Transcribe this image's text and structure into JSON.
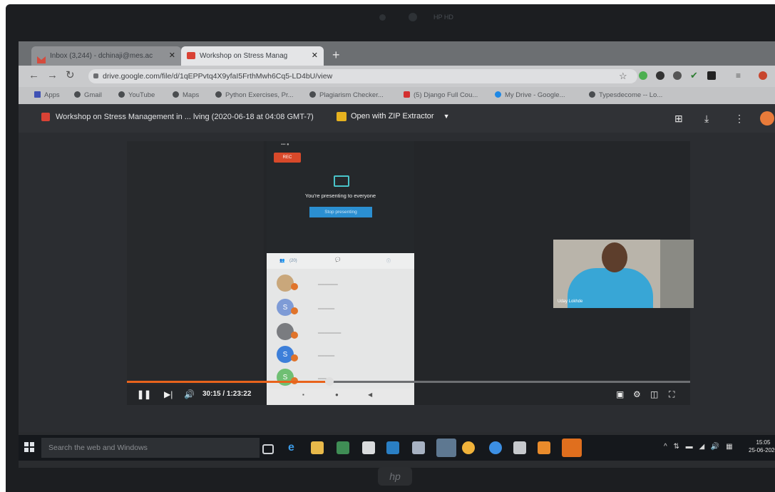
{
  "tabs": [
    {
      "label": "Inbox (3,244) - dchinaji@mes.ac",
      "icon": "gmail-icon",
      "active": false
    },
    {
      "label": "Workshop on Stress Manag",
      "icon": "drive-slides-icon",
      "active": true
    }
  ],
  "omnibox": {
    "url": "drive.google.com/file/d/1qEPPvtq4X9yfaI5FrthMwh6Cq5-LD4bU/view"
  },
  "bookmarks": [
    "Apps",
    "Gmail",
    "YouTube",
    "Maps",
    "Python Exercises, Pr...",
    "Plagiarism Checker...",
    "(5) Django Full Cou...",
    "My Drive - Google...",
    "Typesdecome -- Lo..."
  ],
  "viewer": {
    "title": "Workshop on Stress Management in ... lving (2020-06-18 at 04:08 GMT-7)",
    "open_with": "Open with ZIP Extractor"
  },
  "video": {
    "rec_label": "REC",
    "presenting_text": "You're presenting to everyone",
    "stop_button": "Stop presenting",
    "time_display": "30:15 / 1:23:22",
    "progress_fraction": 0.36,
    "participant_tabs": [
      "(20)"
    ],
    "participants": [
      {
        "initial": ""
      },
      {
        "initial": "S"
      },
      {
        "initial": ""
      },
      {
        "initial": "S"
      },
      {
        "initial": "S"
      }
    ],
    "camera_name": "Uday Lokhde"
  },
  "taskbar": {
    "search_placeholder": "Search the web and Windows",
    "clock_time": "15:05",
    "clock_date": "25-06-2020"
  },
  "camera_text": "HP HD",
  "brand": "hp"
}
